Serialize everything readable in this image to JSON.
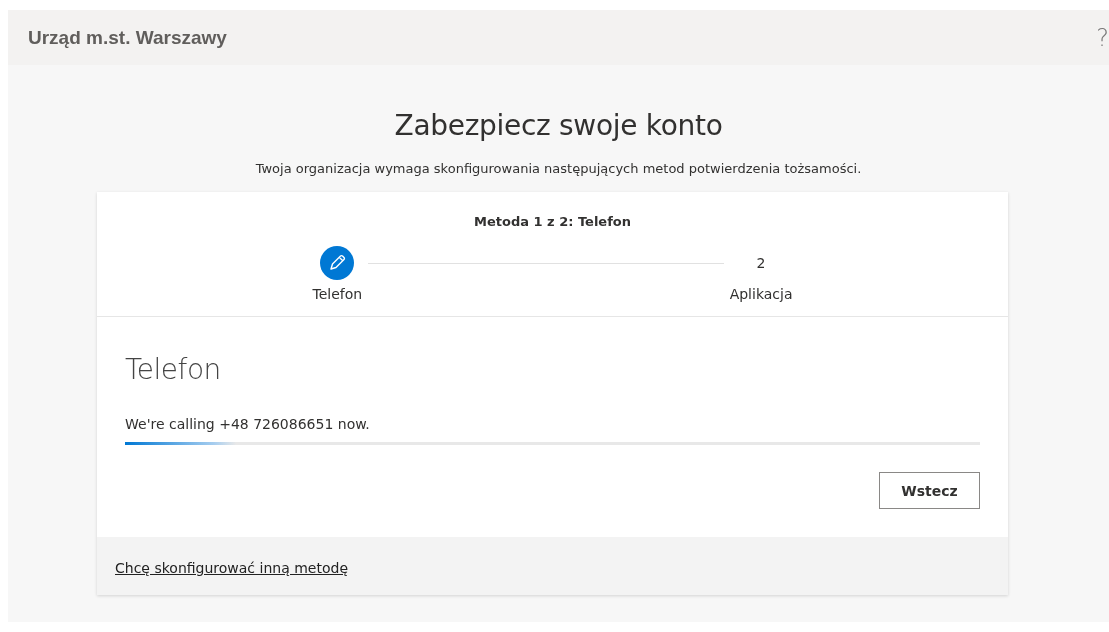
{
  "header": {
    "title": "Urząd m.st. Warszawy",
    "help": "?"
  },
  "page": {
    "title": "Zabezpiecz swoje konto",
    "subtitle": "Twoja organizacja wymaga skonfigurowania następujących metod potwierdzenia tożsamości."
  },
  "wizard": {
    "heading": "Metoda 1 z 2: Telefon",
    "steps": [
      {
        "label": "Telefon",
        "selected": true
      },
      {
        "number": "2",
        "label": "Aplikacja",
        "selected": false
      }
    ]
  },
  "section": {
    "title": "Telefon",
    "message": "We're calling +48 726086651 now.",
    "progress": {
      "level": 0.13
    },
    "back_button": "Wstecz"
  },
  "footer": {
    "link": "Chcę skonfigurować inną metodę"
  }
}
